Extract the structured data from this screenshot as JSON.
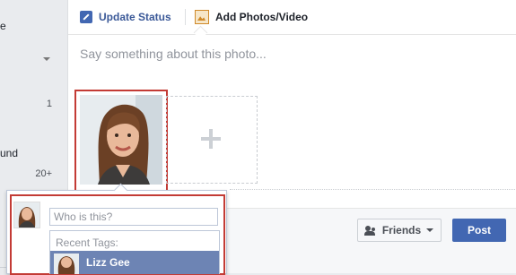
{
  "sidebar": {
    "fragments": [
      "e",
      "und"
    ],
    "counts": [
      "1",
      "20+"
    ]
  },
  "composer": {
    "tabs": [
      {
        "label": "Update Status",
        "icon": "pencil-icon"
      },
      {
        "label": "Add Photos/Video",
        "icon": "photo-icon"
      }
    ],
    "placeholder": "Say something about this photo...",
    "add_more_icon": "plus-icon"
  },
  "tagging": {
    "input_placeholder": "Who is this?",
    "recent_label": "Recent Tags:",
    "suggestions": [
      {
        "name": "Lizz Gee"
      }
    ]
  },
  "footer": {
    "audience_label": "Friends",
    "post_label": "Post"
  },
  "colors": {
    "brand": "#4267b2",
    "highlight_border": "#c33b35",
    "selected_suggestion": "#6d84b4"
  }
}
